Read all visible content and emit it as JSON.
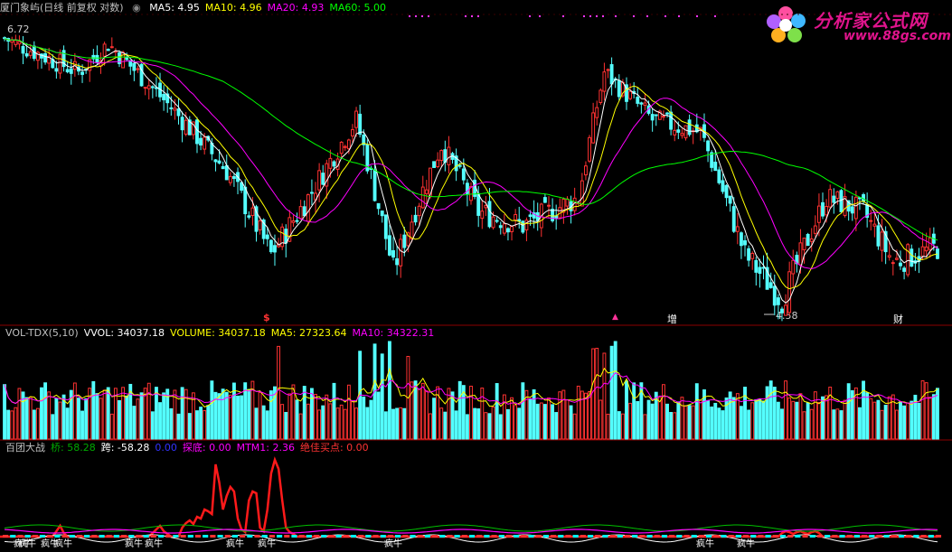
{
  "main_panel": {
    "title": "厦门象屿(日线 前复权 对数)",
    "ma_labels": [
      {
        "label": "MA5: 4.95",
        "color": "#ffffff"
      },
      {
        "label": "MA10: 4.96",
        "color": "#ffff00"
      },
      {
        "label": "MA20: 4.93",
        "color": "#ff00ff"
      },
      {
        "label": "MA60: 5.00",
        "color": "#00ff00"
      }
    ],
    "high_label": "6.72",
    "low_label": "4.58",
    "markers": [
      {
        "text": "$",
        "color": "#ff3333"
      },
      {
        "text": "▲",
        "color": "#ff3399"
      },
      {
        "text": "增",
        "color": "#ffffff"
      },
      {
        "text": "财",
        "color": "#ffffff"
      }
    ]
  },
  "volume_panel": {
    "labels": [
      {
        "label": "VOL-TDX(5,10)",
        "color": "#c0c0c0"
      },
      {
        "label": "VVOL: 34037.18",
        "color": "#ffffff"
      },
      {
        "label": "VOLUME: 34037.18",
        "color": "#ffff00"
      },
      {
        "label": "MA5: 27323.64",
        "color": "#ffff00"
      },
      {
        "label": "MA10: 34322.31",
        "color": "#ff00ff"
      }
    ]
  },
  "indicator_panel": {
    "labels": [
      {
        "label": "百团大战",
        "color": "#c0c0c0"
      },
      {
        "label": "桥: 58.28",
        "color": "#00aa00"
      },
      {
        "label": "跨: -58.28",
        "color": "#ffffff"
      },
      {
        "label": "0.00",
        "color": "#3333ff"
      },
      {
        "label": "探底: 0.00",
        "color": "#ff00ff"
      },
      {
        "label": "MTM1: 2.36",
        "color": "#ff00ff"
      },
      {
        "label": "绝佳买点: 0.00",
        "color": "#ff3333"
      }
    ],
    "bottom_tags": [
      "疯牛",
      "疯牛",
      "疯牛",
      "疯牛",
      "疯牛",
      "疯牛",
      "疯牛",
      "疯牛",
      "疯牛",
      "疯牛",
      "疯牛"
    ]
  },
  "logo": {
    "name": "分析家公式网",
    "url": "www.88gs.com"
  },
  "chart_data": {
    "type": "line",
    "title": "厦门象屿(日线 前复权 对数)",
    "panels": [
      "price",
      "volume",
      "indicator"
    ],
    "price_extremes": {
      "high": 6.72,
      "low": 4.58
    },
    "price_keypoints": [
      {
        "i": 0,
        "close": 6.6
      },
      {
        "i": 20,
        "close": 6.3
      },
      {
        "i": 28,
        "close": 6.55
      },
      {
        "i": 45,
        "close": 6.0
      },
      {
        "i": 60,
        "close": 5.5
      },
      {
        "i": 72,
        "close": 4.9
      },
      {
        "i": 82,
        "close": 5.3
      },
      {
        "i": 95,
        "close": 5.9
      },
      {
        "i": 105,
        "close": 4.8
      },
      {
        "i": 118,
        "close": 5.7
      },
      {
        "i": 128,
        "close": 5.2
      },
      {
        "i": 140,
        "close": 5.1
      },
      {
        "i": 155,
        "close": 5.3
      },
      {
        "i": 162,
        "close": 6.3
      },
      {
        "i": 175,
        "close": 5.9
      },
      {
        "i": 188,
        "close": 5.8
      },
      {
        "i": 200,
        "close": 4.9
      },
      {
        "i": 210,
        "close": 4.6
      },
      {
        "i": 222,
        "close": 5.3
      },
      {
        "i": 232,
        "close": 5.2
      },
      {
        "i": 240,
        "close": 4.85
      },
      {
        "i": 252,
        "close": 4.95
      }
    ],
    "volume_last": 34037.18,
    "volume_ma5": 27323.64,
    "volume_ma10": 34322.31
  }
}
